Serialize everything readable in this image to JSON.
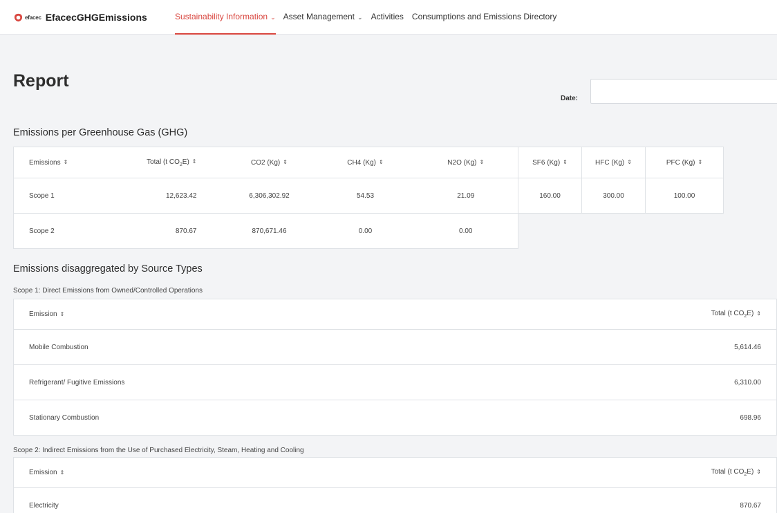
{
  "brand": {
    "small": "efacec",
    "name": "EfacecGHGEmissions",
    "accent": "#d9463f"
  },
  "nav": [
    {
      "label": "Sustainability Information",
      "dropdown": true,
      "active": true
    },
    {
      "label": "Asset Management",
      "dropdown": true,
      "active": false
    },
    {
      "label": "Activities",
      "dropdown": false,
      "active": false
    },
    {
      "label": "Consumptions and Emissions Directory",
      "dropdown": false,
      "active": false
    }
  ],
  "page": {
    "title": "Report",
    "date_label": "Date:",
    "date_value": ""
  },
  "ghg": {
    "title": "Emissions per Greenhouse Gas (GHG)",
    "headers": [
      "Emissions",
      "Total (t CO",
      "CO2 (Kg)",
      "CH4  (Kg)",
      "N2O (Kg)"
    ],
    "total_sub": "2",
    "total_suffix": "E)",
    "rows": [
      [
        "Scope 1",
        "12,623.42",
        "6,306,302.92",
        "54.53",
        "21.09"
      ],
      [
        "Scope 2",
        "870.67",
        "870,671.46",
        "0.00",
        "0.00"
      ]
    ],
    "extra_headers": [
      "SF6 (Kg)",
      "HFC  (Kg)",
      "PFC (Kg)"
    ],
    "extra_row": [
      "160.00",
      "300.00",
      "100.00"
    ]
  },
  "sources": {
    "title": "Emissions disaggregated by Source Types",
    "scope1": {
      "caption": "Scope 1: Direct Emissions from Owned/Controlled Operations",
      "col_emission": "Emission",
      "col_total": "Total (t CO",
      "rows": [
        {
          "name": "Mobile Combustion",
          "total": "5,614.46"
        },
        {
          "name": "Refrigerant/ Fugitive Emissions",
          "total": "6,310.00"
        },
        {
          "name": "Stationary Combustion",
          "total": "698.96"
        }
      ]
    },
    "scope2": {
      "caption": "Scope 2: Indirect Emissions from the Use of Purchased Electricity, Steam, Heating and Cooling",
      "col_emission": "Emission",
      "col_total": "Total (t CO",
      "rows": [
        {
          "name": "Electricity",
          "total": "870.67"
        }
      ]
    }
  },
  "icons": {
    "sort": "sort-icon",
    "chevron": "chevron-down-icon",
    "logo": "efacec-logo-icon"
  }
}
